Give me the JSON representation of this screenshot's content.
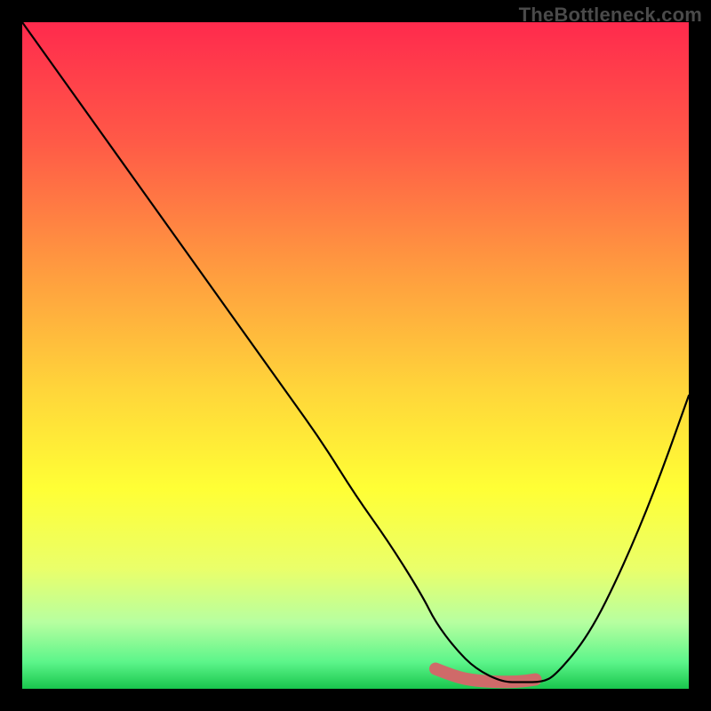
{
  "watermark": "TheBottleneck.com",
  "chart_data": {
    "type": "line",
    "title": "",
    "xlabel": "",
    "ylabel": "",
    "xlim": [
      0,
      100
    ],
    "ylim": [
      0,
      100
    ],
    "grid": false,
    "legend": false,
    "curve": {
      "name": "bottleneck-curve",
      "x": [
        0,
        5,
        10,
        15,
        20,
        25,
        30,
        35,
        40,
        45,
        50,
        55,
        60,
        62,
        65,
        68,
        72,
        75,
        78,
        80,
        85,
        90,
        95,
        100
      ],
      "y": [
        100,
        93,
        86,
        79,
        72,
        65,
        58,
        51,
        44,
        37,
        29,
        22,
        14,
        10,
        6,
        3,
        1,
        1,
        1,
        2,
        8,
        18,
        30,
        44
      ]
    },
    "highlight_segment": {
      "name": "optimal-zone",
      "x": [
        62,
        65,
        68,
        72,
        75,
        77
      ],
      "y": [
        3,
        1.8,
        1.2,
        1.0,
        1.1,
        1.4
      ],
      "color": "#cf6a69",
      "stroke_width": 14
    },
    "gradient_stops": [
      {
        "offset": 0.0,
        "color": "#ff2a4d"
      },
      {
        "offset": 0.18,
        "color": "#ff5a47"
      },
      {
        "offset": 0.38,
        "color": "#ff9e3f"
      },
      {
        "offset": 0.55,
        "color": "#ffd53a"
      },
      {
        "offset": 0.7,
        "color": "#ffff35"
      },
      {
        "offset": 0.82,
        "color": "#eaff6a"
      },
      {
        "offset": 0.9,
        "color": "#b7ffa0"
      },
      {
        "offset": 0.96,
        "color": "#5cf58a"
      },
      {
        "offset": 1.0,
        "color": "#19c64d"
      }
    ]
  }
}
